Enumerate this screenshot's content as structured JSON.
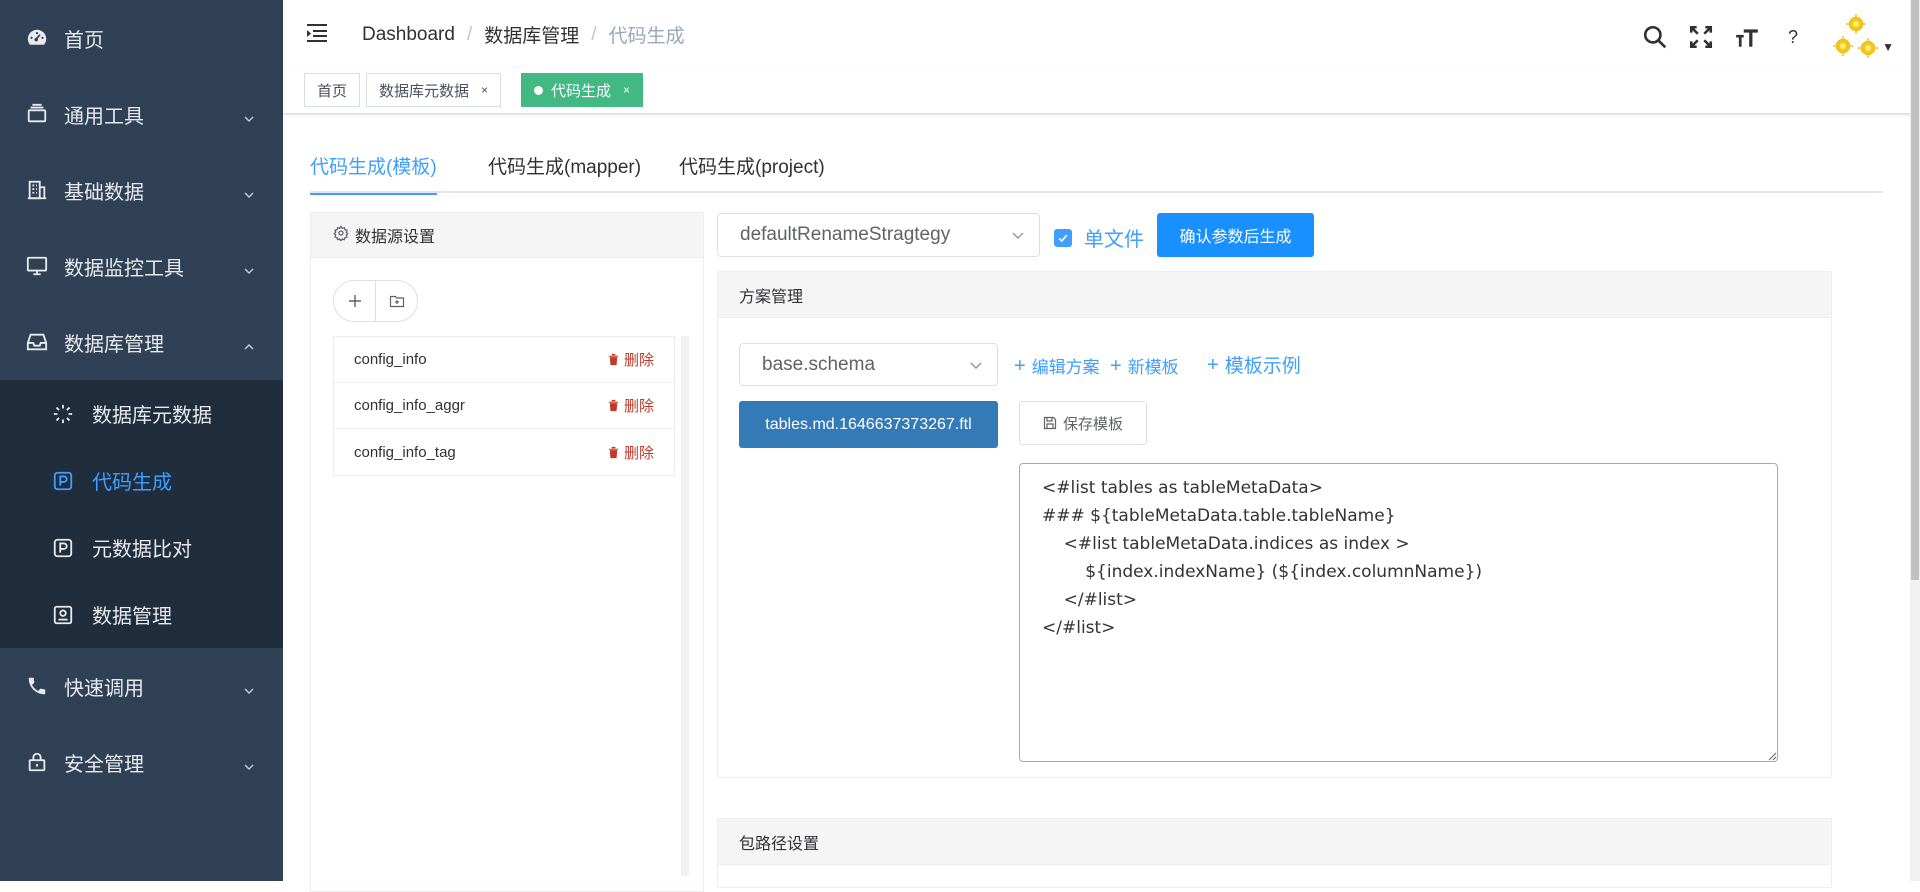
{
  "sidebar": {
    "items": [
      {
        "label": "首页",
        "icon": "dashboard-icon"
      },
      {
        "label": "通用工具",
        "icon": "toolbox-icon"
      },
      {
        "label": "基础数据",
        "icon": "building-icon"
      },
      {
        "label": "数据监控工具",
        "icon": "monitor-icon"
      },
      {
        "label": "数据库管理",
        "icon": "inbox-icon",
        "expanded": true
      },
      {
        "label": "快速调用",
        "icon": "phone-icon"
      },
      {
        "label": "安全管理",
        "icon": "lock-icon"
      }
    ],
    "submenu": [
      {
        "label": "数据库元数据",
        "icon": "loading-icon"
      },
      {
        "label": "代码生成",
        "icon": "parking-icon",
        "active": true
      },
      {
        "label": "元数据比对",
        "icon": "parking-icon"
      },
      {
        "label": "数据管理",
        "icon": "data-manage-icon"
      }
    ],
    "active_color": "#409eff",
    "bg_color": "#304156"
  },
  "header": {
    "breadcrumb": [
      "Dashboard",
      "数据库管理",
      "代码生成"
    ],
    "help_label": "?"
  },
  "tags": [
    {
      "label": "首页"
    },
    {
      "label": "数据库元数据",
      "close": "×"
    },
    {
      "label": "代码生成",
      "close": "×",
      "active": true
    }
  ],
  "tabs": [
    "代码生成(模板)",
    "代码生成(mapper)",
    "代码生成(project)"
  ],
  "datasource": {
    "title": "数据源设置",
    "rows": [
      {
        "name": "config_info",
        "action": "删除"
      },
      {
        "name": "config_info_aggr",
        "action": "删除"
      },
      {
        "name": "config_info_tag",
        "action": "删除"
      }
    ]
  },
  "toolbar": {
    "strategy": "defaultRenameStragtegy",
    "single_file_label": "单文件",
    "single_file_checked": true,
    "confirm_label": "确认参数后生成"
  },
  "scheme": {
    "title": "方案管理",
    "selected": "base.schema",
    "edit_label": "编辑方案",
    "new_tpl_label": "新模板",
    "example_label": "模板示例",
    "template_file": "tables.md.1646637373267.ftl",
    "save_label": "保存模板",
    "code": "<#list tables as tableMetaData>\n### ${tableMetaData.table.tableName}\n    <#list tableMetaData.indices as index >\n        ${index.indexName} (${index.columnName})\n    </#list>\n</#list>"
  },
  "package": {
    "title": "包路径设置"
  }
}
